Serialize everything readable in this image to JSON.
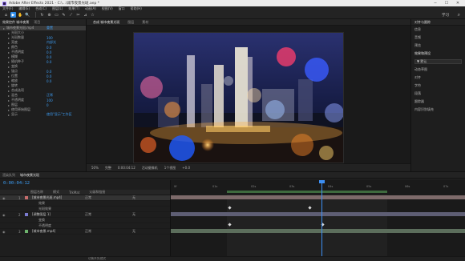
{
  "titlebar": {
    "title": "Adobe After Effects 2021 - C:\\...\\城市夜景光斑.aep *"
  },
  "menu": [
    "文件(F)",
    "编辑(E)",
    "合成(C)",
    "图层(L)",
    "效果(T)",
    "动画(A)",
    "视图(V)",
    "窗口",
    "帮助(H)"
  ],
  "toolbar": {
    "tools": [
      "⌂",
      "▶",
      "✋",
      "🔍",
      "↻",
      "⊕",
      "▭",
      "✎",
      "⟋",
      "✂",
      "⊿",
      "☆"
    ],
    "workspace": "学习",
    "search": "⌕"
  },
  "project": {
    "tabs": [
      "效果控件 城市夜景",
      "项目"
    ],
    "rows": [
      {
        "label": "城市夜景光斑.mp4",
        "value": "重置"
      },
      {
        "label": "光斑大小",
        "value": ""
      },
      {
        "label": "光斑数量",
        "value": "100"
      },
      {
        "label": "亮度",
        "value": "内部光"
      },
      {
        "label": "颜色",
        "value": "0.0"
      },
      {
        "label": "不透明度",
        "value": "0.0"
      },
      {
        "label": "模糊",
        "value": "0.0"
      },
      {
        "label": "随机种子",
        "value": "0.0"
      },
      {
        "label": "变换",
        "value": ""
      },
      {
        "label": "锚点",
        "value": "0.0"
      },
      {
        "label": "位置",
        "value": "0.0"
      },
      {
        "label": "缩放",
        "value": "0.0"
      },
      {
        "label": "旋转",
        "value": ""
      },
      {
        "label": "合成选项",
        "value": ""
      },
      {
        "label": "混合",
        "value": "正常"
      },
      {
        "label": "不透明度",
        "value": "100"
      },
      {
        "label": "图层",
        "value": "0"
      },
      {
        "label": "使用原始图层",
        "value": ""
      },
      {
        "label": "显示",
        "value": "使用\"显示\"工作区"
      }
    ]
  },
  "viewer": {
    "tabs": [
      "合成 城市夜景光斑",
      "图层",
      "素材"
    ],
    "controls": [
      "50%",
      "完整",
      "0:00:04:12",
      "活动摄像机",
      "1个视图",
      "+0.0"
    ]
  },
  "right_panel": {
    "header": "对齐与跟踪",
    "items": [
      "信息",
      "音频",
      "预览",
      "效果和预设",
      "动态草图",
      "对齐",
      "字符",
      "段落",
      "跟踪器",
      "内容识别填充"
    ],
    "select": "▼ 默认"
  },
  "timeline": {
    "tabs": [
      "渲染队列",
      "城市夜景光斑"
    ],
    "timecode": "0:00:04:12",
    "headers": [
      "图层名称",
      "模式",
      "TrkMat",
      "父级和链接"
    ],
    "ruler": [
      "0f",
      "01s",
      "02s",
      "03s",
      "04s",
      "05s",
      "06s",
      "07s"
    ],
    "layers": [
      {
        "num": "1",
        "name": "[城市夜景光斑.mp4]",
        "mode": "正常",
        "parent": "无",
        "color": "#c76d6d",
        "sub": false,
        "sel": true
      },
      {
        "num": "",
        "name": "效果",
        "mode": "",
        "parent": "",
        "color": "",
        "sub": true,
        "sel": false
      },
      {
        "num": "",
        "name": "光斑效果",
        "mode": "",
        "parent": "",
        "color": "",
        "sub": true,
        "sel": false
      },
      {
        "num": "2",
        "name": "[调整图层 1]",
        "mode": "正常",
        "parent": "无",
        "color": "#7b7bd0",
        "sub": false,
        "sel": false
      },
      {
        "num": "",
        "name": "变换",
        "mode": "",
        "parent": "",
        "color": "",
        "sub": true,
        "sel": false
      },
      {
        "num": "",
        "name": "不透明度",
        "mode": "",
        "parent": "",
        "color": "",
        "sub": true,
        "sel": false
      },
      {
        "num": "3",
        "name": "[城市夜景.mp4]",
        "mode": "正常",
        "parent": "无",
        "color": "#6db36d",
        "sub": false,
        "sel": false
      }
    ],
    "footer": "切换开关/模式"
  }
}
